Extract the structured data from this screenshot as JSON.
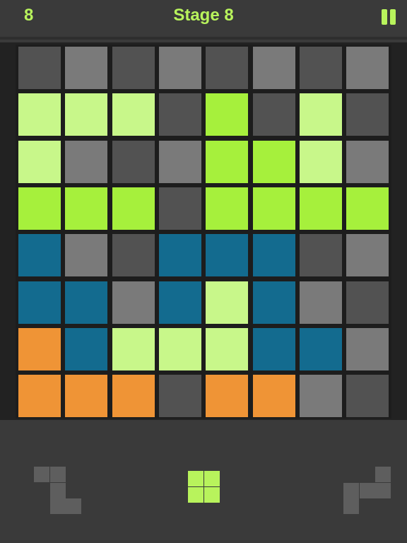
{
  "header": {
    "score": "8",
    "stage_title": "Stage 8"
  },
  "colors": {
    "accent": "#b8f35c",
    "dark": "#525252",
    "mid": "#7a7a7a",
    "light_green": "#c8f78a",
    "green": "#a6f03c",
    "blue": "#136b8f",
    "orange": "#ef9436",
    "piece_gray": "#5e5e5e"
  },
  "board": {
    "rows": 8,
    "cols": 8,
    "grid": [
      [
        "dark",
        "mid",
        "dark",
        "mid",
        "dark",
        "mid",
        "dark",
        "mid"
      ],
      [
        "light_green",
        "light_green",
        "light_green",
        "dark",
        "green",
        "dark",
        "light_green",
        "dark"
      ],
      [
        "light_green",
        "mid",
        "dark",
        "mid",
        "green",
        "green",
        "light_green",
        "mid"
      ],
      [
        "green",
        "green",
        "green",
        "dark",
        "green",
        "green",
        "green",
        "green"
      ],
      [
        "blue",
        "mid",
        "dark",
        "blue",
        "blue",
        "blue",
        "dark",
        "mid"
      ],
      [
        "blue",
        "blue",
        "mid",
        "blue",
        "light_green",
        "blue",
        "mid",
        "dark"
      ],
      [
        "orange",
        "blue",
        "light_green",
        "light_green",
        "light_green",
        "blue",
        "blue",
        "mid"
      ],
      [
        "orange",
        "orange",
        "orange",
        "dark",
        "orange",
        "orange",
        "mid",
        "dark"
      ]
    ]
  },
  "tray": {
    "pieces": [
      {
        "name": "piece-left",
        "color": "piece_gray",
        "cells": [
          [
            0,
            0
          ],
          [
            1,
            0
          ],
          [
            1,
            1
          ],
          [
            1,
            2
          ],
          [
            2,
            2
          ]
        ]
      },
      {
        "name": "piece-center",
        "color": "accent",
        "cells": [
          [
            0,
            0
          ],
          [
            1,
            0
          ],
          [
            0,
            1
          ],
          [
            1,
            1
          ]
        ]
      },
      {
        "name": "piece-right",
        "color": "piece_gray",
        "cells": [
          [
            2,
            0
          ],
          [
            0,
            1
          ],
          [
            1,
            1
          ],
          [
            2,
            1
          ],
          [
            0,
            2
          ]
        ]
      }
    ]
  }
}
